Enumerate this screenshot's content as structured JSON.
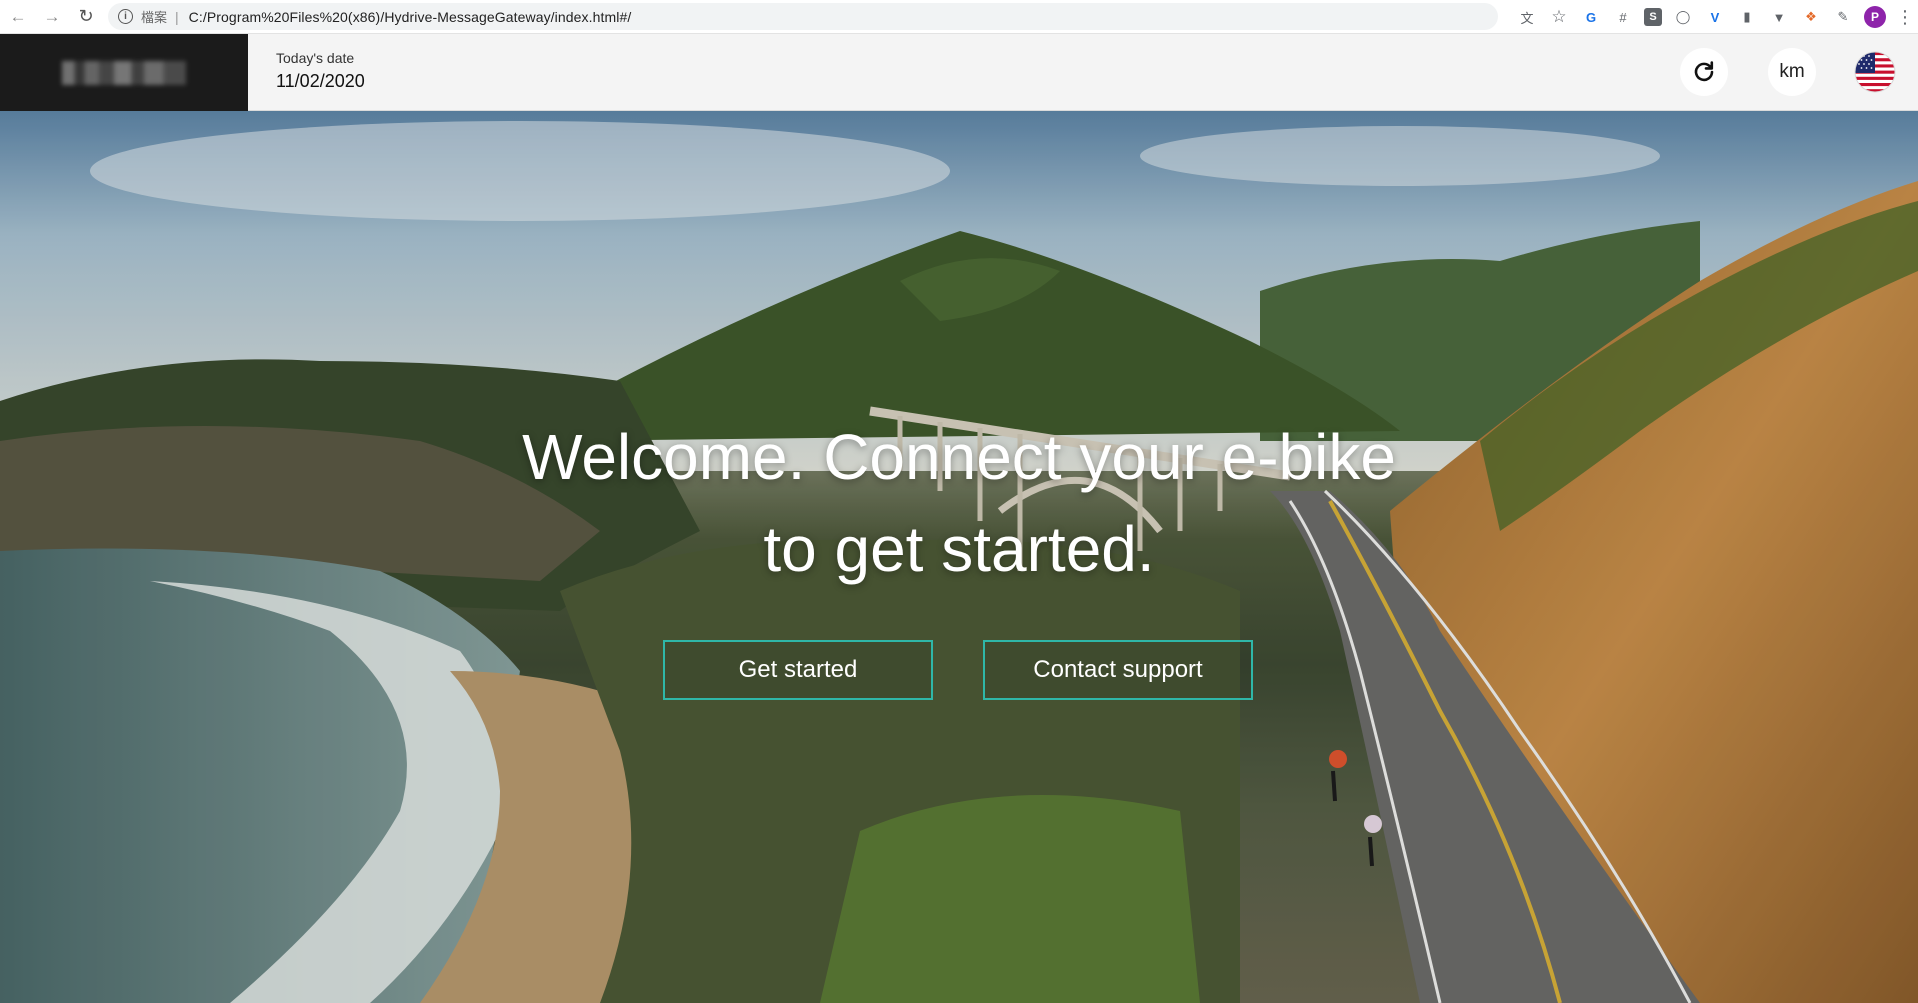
{
  "browser": {
    "scheme_label": "檔案",
    "url": "C:/Program%20Files%20(x86)/Hydrive-MessageGateway/index.html#/",
    "profile_initial": "P"
  },
  "header": {
    "date_label": "Today's date",
    "date_value": "11/02/2020",
    "units_label": "km",
    "language_flag": "us-flag-icon"
  },
  "hero": {
    "title_line1": "Welcome. Connect your e-bike",
    "title_line2": "to get started.",
    "accent_color": "#2fb7a8",
    "buttons": {
      "get_started": "Get started",
      "contact_support": "Contact support"
    }
  }
}
